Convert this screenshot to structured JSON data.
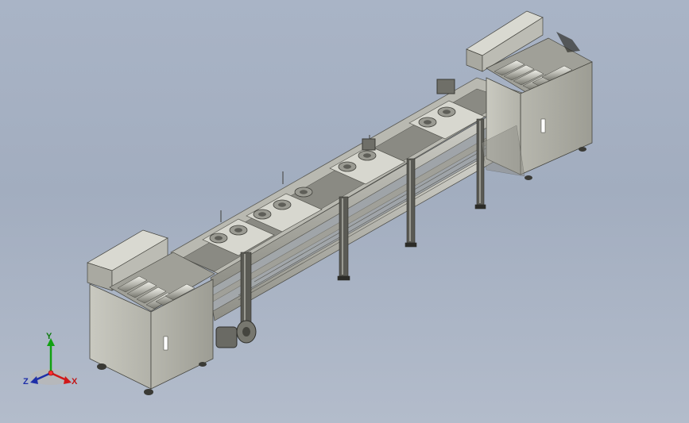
{
  "viewport": {
    "background_top": "#a9b4c6",
    "background_bottom": "#b3bccb"
  },
  "model": {
    "description_icon": "conveyor-assembly-model",
    "frame_color": "#c9c9bf",
    "steel_color": "#7c7c74",
    "dark_color": "#3f3f3a"
  },
  "triad": {
    "x_label": "X",
    "y_label": "Y",
    "z_label": "Z",
    "x_color": "#d01818",
    "y_color": "#11a111",
    "z_color": "#1e2fa8"
  }
}
